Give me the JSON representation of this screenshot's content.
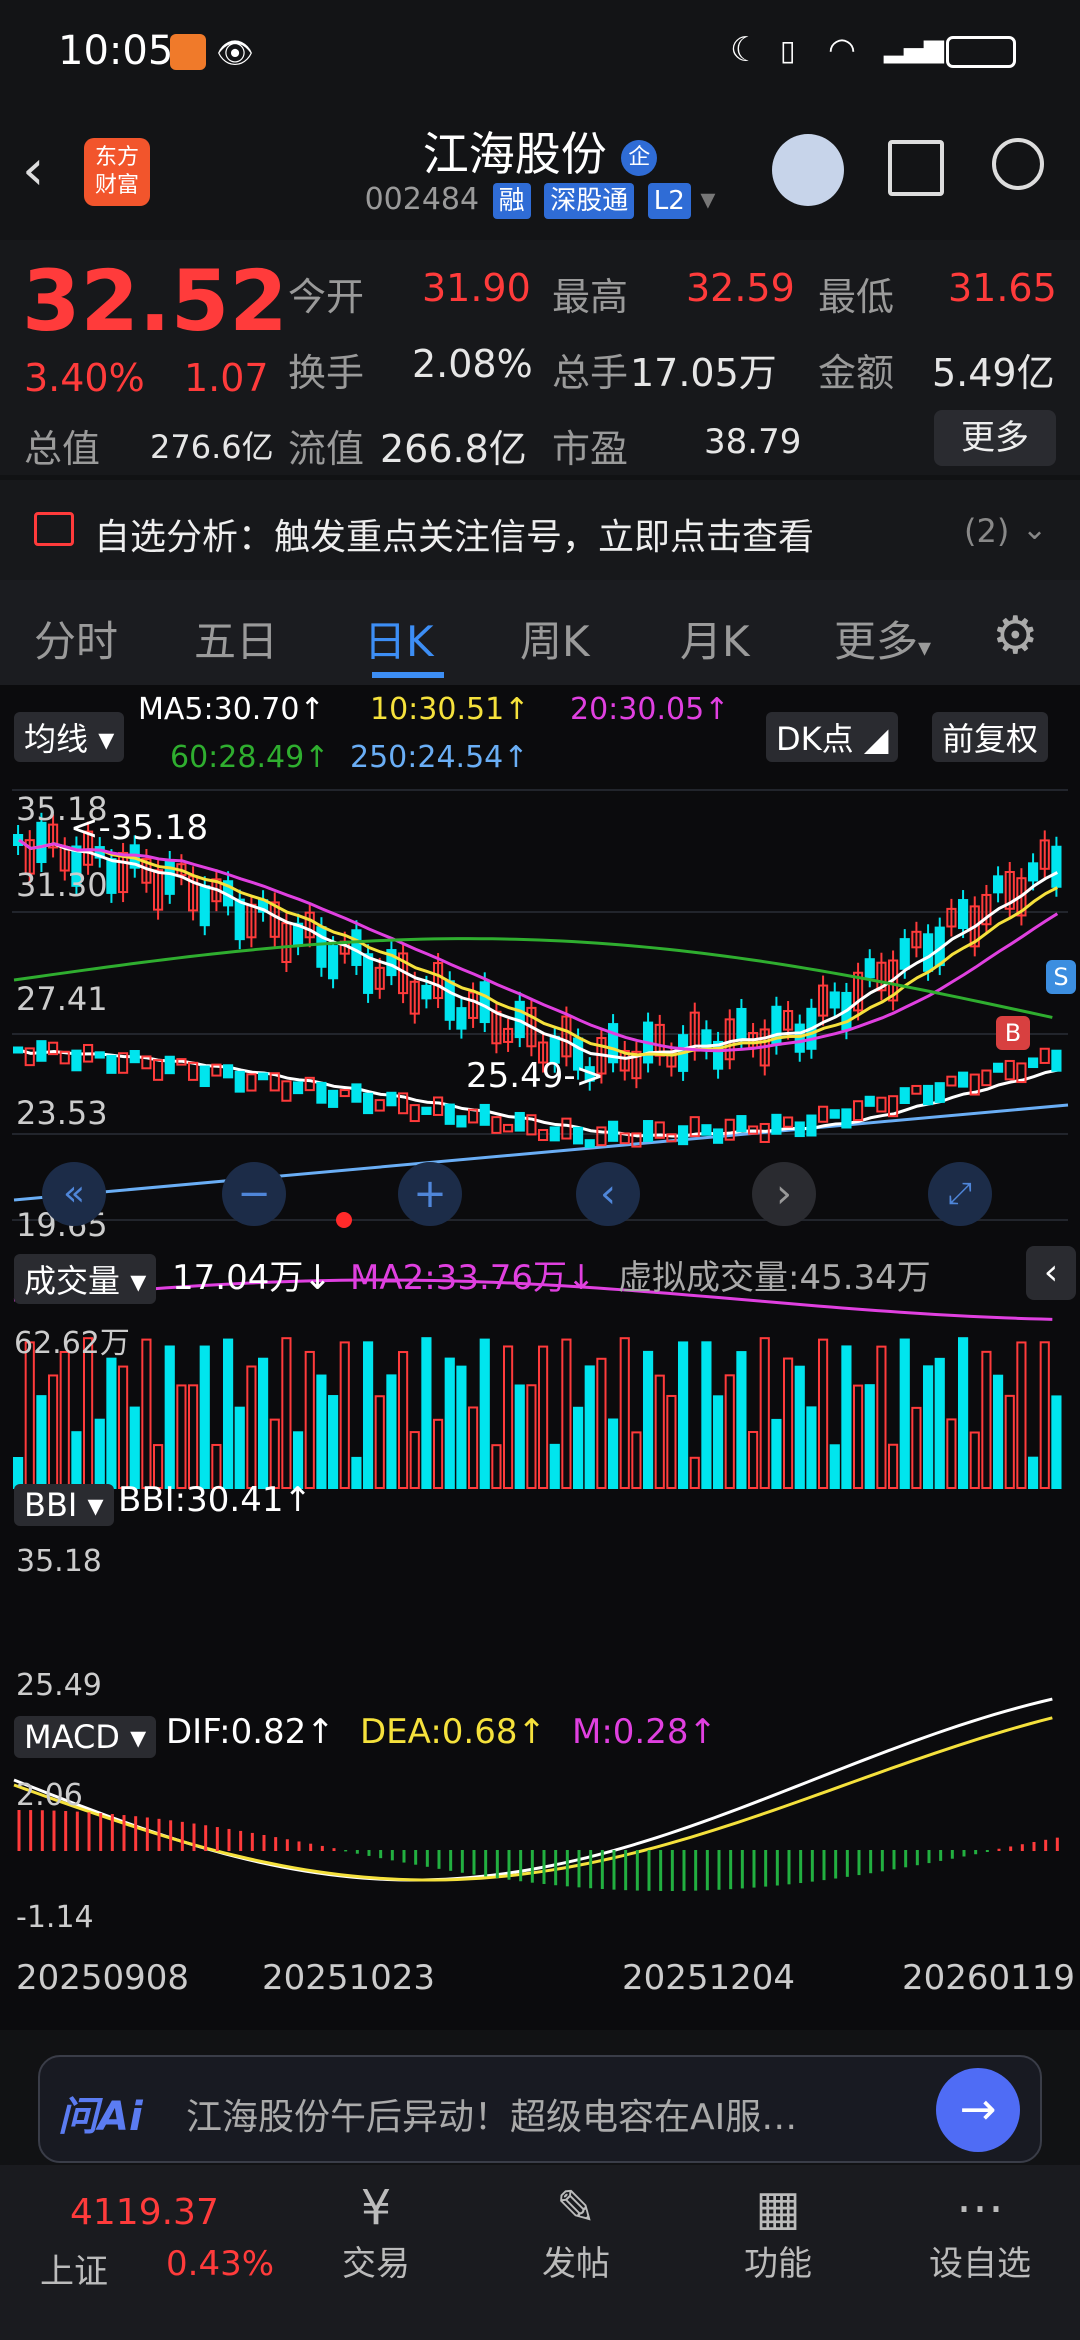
{
  "status_bar": {
    "time": "10:05"
  },
  "header": {
    "logo": "东方\n财富",
    "title": "江海股份",
    "title_badge": "企",
    "code": "002484",
    "tags": [
      "融",
      "深股通",
      "L2"
    ]
  },
  "quote": {
    "price": "32.52",
    "change_pct": "3.40%",
    "change_amt": "1.07",
    "fields": [
      {
        "label": "今开",
        "value": "31.90"
      },
      {
        "label": "最高",
        "value": "32.59"
      },
      {
        "label": "最低",
        "value": "31.65"
      },
      {
        "label": "换手",
        "value": "2.08%"
      },
      {
        "label": "总手",
        "value": "17.05万"
      },
      {
        "label": "金额",
        "value": "5.49亿"
      },
      {
        "label": "总值",
        "value": "276.6亿"
      },
      {
        "label": "流值",
        "value": "266.8亿"
      },
      {
        "label": "市盈",
        "value": "38.79"
      }
    ],
    "more": "更多"
  },
  "banner": {
    "text": "自选分析：触发重点关注信号，立即点击查看",
    "count": "(2)"
  },
  "tabs": [
    "分时",
    "五日",
    "日K",
    "周K",
    "月K",
    "更多"
  ],
  "ma_panel": {
    "selector": "均线",
    "ma5": "MA5:30.70↑",
    "ma10": "10:30.51↑",
    "ma20": "20:30.05↑",
    "ma60": "60:28.49↑",
    "ma250": "250:24.54↑",
    "dk": "DK点",
    "fq": "前复权"
  },
  "kchart": {
    "ticks": [
      "35.18",
      "31.30",
      "27.41",
      "23.53",
      "19.65"
    ],
    "high_label": "<-35.18",
    "low_label": "25.49->",
    "b_mark": "B",
    "s_mark": "S"
  },
  "volume": {
    "selector": "成交量",
    "vol": "17.04万↓",
    "ma2": "MA2:33.76万↓",
    "virtual": "虚拟成交量:45.34万",
    "max": "62.62万"
  },
  "bbi": {
    "selector": "BBI",
    "value": "BBI:30.41↑",
    "top": "35.18",
    "bottom": "25.49"
  },
  "macd": {
    "selector": "MACD",
    "dif": "DIF:0.82↑",
    "dea": "DEA:0.68↑",
    "m": "M:0.28↑",
    "top": "2.06",
    "bottom": "-1.14"
  },
  "dates": [
    "20250908",
    "20251023",
    "20251204",
    "20260119"
  ],
  "ask": {
    "logo": "问Ai",
    "text": "江海股份午后异动！超级电容在AI服…"
  },
  "bottom_nav": {
    "index_name": "上证",
    "index_value": "4119.37",
    "index_pct": "0.43%",
    "items": [
      "交易",
      "发帖",
      "功能",
      "设自选"
    ]
  },
  "colors": {
    "up": "#ff3b3b",
    "down": "#00e5ee",
    "ma5": "#ffffff",
    "ma10": "#f5e13c",
    "ma20": "#e040e0",
    "ma60": "#2fae2f",
    "ma250": "#6aaef5"
  }
}
